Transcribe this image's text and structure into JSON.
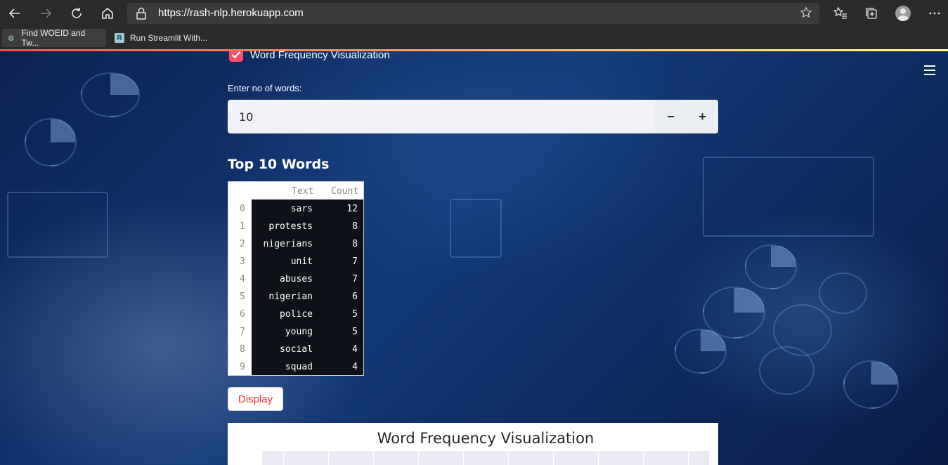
{
  "browser": {
    "url": "https://rash-nlp.herokuapp.com",
    "bookmarks": [
      {
        "label": "Find WOEID and Tw..."
      },
      {
        "label": "Run Streamlit With..."
      }
    ],
    "bookmark_icon_letter": "R"
  },
  "app": {
    "checkbox_label": "Word Frequency Visualization",
    "checkbox_checked": true,
    "input_label": "Enter no of words:",
    "input_value": "10",
    "minus_label": "−",
    "plus_label": "+",
    "heading": "Top 10 Words",
    "table": {
      "columns": [
        "Text",
        "Count"
      ],
      "rows": [
        {
          "index": "0",
          "text": "sars",
          "count": "12"
        },
        {
          "index": "1",
          "text": "protests",
          "count": "8"
        },
        {
          "index": "2",
          "text": "nigerians",
          "count": "8"
        },
        {
          "index": "3",
          "text": "unit",
          "count": "7"
        },
        {
          "index": "4",
          "text": "abuses",
          "count": "7"
        },
        {
          "index": "5",
          "text": "nigerian",
          "count": "6"
        },
        {
          "index": "6",
          "text": "police",
          "count": "5"
        },
        {
          "index": "7",
          "text": "young",
          "count": "5"
        },
        {
          "index": "8",
          "text": "social",
          "count": "4"
        },
        {
          "index": "9",
          "text": "squad",
          "count": "4"
        }
      ]
    },
    "display_button": "Display",
    "chart_title": "Word Frequency Visualization"
  },
  "colors": {
    "accent": "#ff4b6e",
    "button_text": "#ff2b2b"
  }
}
